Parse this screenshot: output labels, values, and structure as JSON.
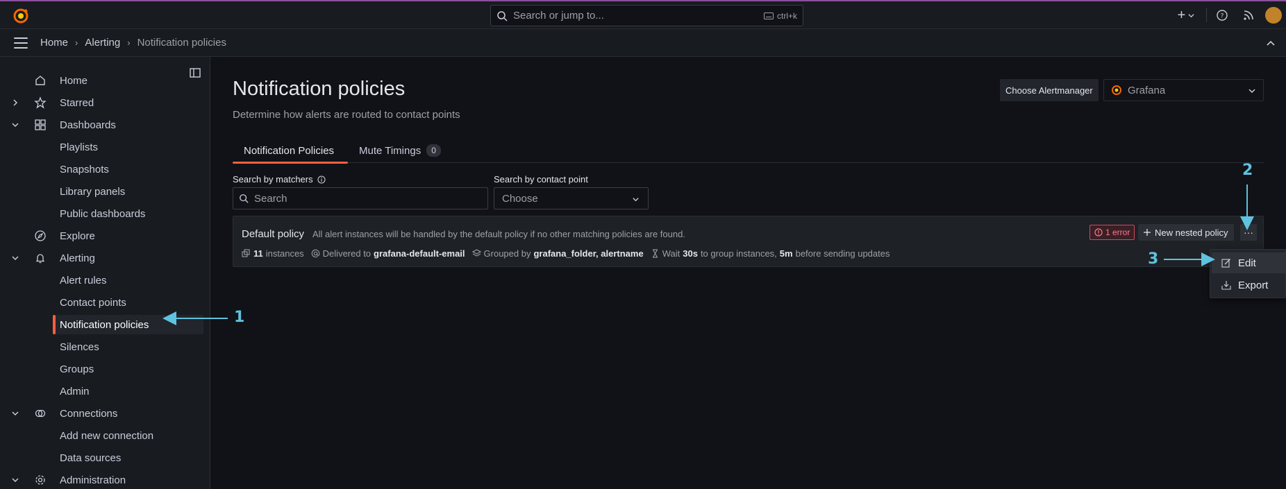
{
  "topbar": {
    "search_placeholder": "Search or jump to...",
    "shortcut": "ctrl+k",
    "plus_label": "+"
  },
  "breadcrumb": {
    "items": [
      "Home",
      "Alerting",
      "Notification policies"
    ]
  },
  "sidebar": {
    "items": [
      {
        "label": "Home"
      },
      {
        "label": "Starred"
      },
      {
        "label": "Dashboards"
      },
      {
        "label": "Playlists"
      },
      {
        "label": "Snapshots"
      },
      {
        "label": "Library panels"
      },
      {
        "label": "Public dashboards"
      },
      {
        "label": "Explore"
      },
      {
        "label": "Alerting"
      },
      {
        "label": "Alert rules"
      },
      {
        "label": "Contact points"
      },
      {
        "label": "Notification policies"
      },
      {
        "label": "Silences"
      },
      {
        "label": "Groups"
      },
      {
        "label": "Admin"
      },
      {
        "label": "Connections"
      },
      {
        "label": "Add new connection"
      },
      {
        "label": "Data sources"
      },
      {
        "label": "Administration"
      }
    ]
  },
  "main": {
    "title": "Notification policies",
    "subtitle": "Determine how alerts are routed to contact points",
    "alertmanager_label": "Choose Alertmanager",
    "alertmanager_value": "Grafana",
    "tabs": [
      {
        "label": "Notification Policies"
      },
      {
        "label": "Mute Timings",
        "count": "0"
      }
    ],
    "search_matchers_label": "Search by matchers",
    "search_matchers_placeholder": "Search",
    "search_contact_label": "Search by contact point",
    "search_contact_value": "Choose"
  },
  "policy": {
    "name": "Default policy",
    "description": "All alert instances will be handled by the default policy if no other matching policies are found.",
    "error_badge": "1 error",
    "new_nested_label": "New nested policy",
    "more_label": "···",
    "instances_count": "11",
    "instances_label": "instances",
    "delivered_label": "Delivered to",
    "delivered_value": "grafana-default-email",
    "grouped_label": "Grouped by",
    "grouped_value": "grafana_folder, alertname",
    "wait_label": "Wait",
    "wait_value": "30s",
    "wait_text": "to group instances,",
    "repeat_value": "5m",
    "repeat_text": "before sending updates"
  },
  "menu": {
    "items": [
      {
        "label": "Edit"
      },
      {
        "label": "Export"
      }
    ]
  },
  "annotations": {
    "one": "1",
    "two": "2",
    "three": "3"
  },
  "colors": {
    "accent": "#f55f3e",
    "annotation": "#5fc2de",
    "error": "#d2495b"
  }
}
